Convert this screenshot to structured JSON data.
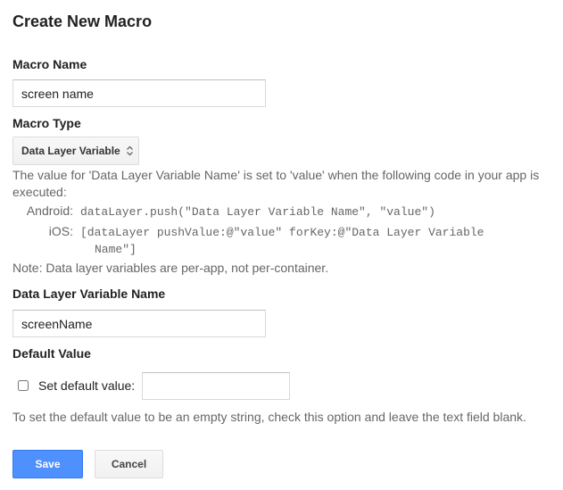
{
  "page_title": "Create New Macro",
  "macro_name": {
    "label": "Macro Name",
    "value": "screen name"
  },
  "macro_type": {
    "label": "Macro Type",
    "selected": "Data Layer Variable"
  },
  "description": {
    "intro_line1": "The value for 'Data Layer Variable Name' is set to 'value' when the following code in your app is",
    "intro_line2": "executed:",
    "android_label": "Android:",
    "android_code": "dataLayer.push(\"Data Layer Variable Name\", \"value\")",
    "ios_label": "iOS:",
    "ios_code_line1": "[dataLayer pushValue:@\"value\" forKey:@\"Data Layer Variable",
    "ios_code_line2": "Name\"]",
    "note": "Note: Data layer variables are per-app, not per-container."
  },
  "variable_name": {
    "label": "Data Layer Variable Name",
    "value": "screenName"
  },
  "default_value": {
    "label": "Default Value",
    "checkbox_label": "Set default value:",
    "checked": false,
    "value": "",
    "hint": "To set the default value to be an empty string, check this option and leave the text field blank."
  },
  "buttons": {
    "save": "Save",
    "cancel": "Cancel"
  },
  "colors": {
    "primary_button": "#4d90fe",
    "text": "#222222",
    "muted_text": "#666666"
  }
}
